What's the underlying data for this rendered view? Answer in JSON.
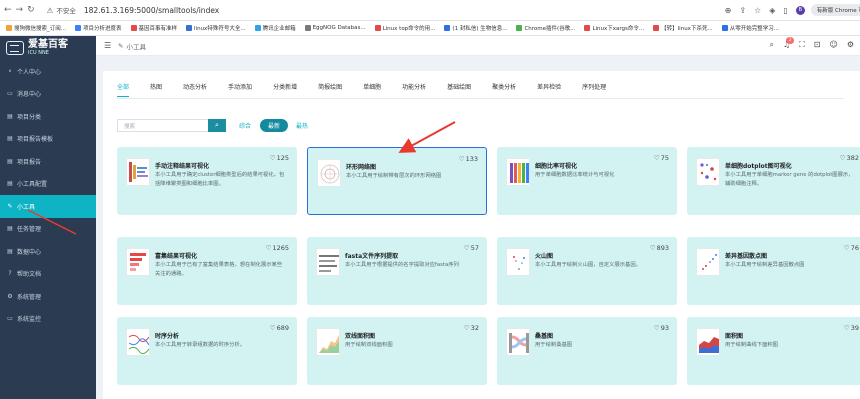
{
  "browser": {
    "nav": {
      "back": "←",
      "forward": "→",
      "reload": "↻"
    },
    "url_warning": "不安全",
    "url": "182.61.3.169:5000/smalltools/index",
    "profile_initial": "B",
    "update_label": "有新版 Chrome 可用"
  },
  "bookmarks": [
    {
      "label": "搜狗微信搜索_订阅...",
      "color": "#f1a33b"
    },
    {
      "label": "项目分析进度表",
      "color": "#3b82f6"
    },
    {
      "label": "基因百事有准样",
      "color": "#e14b4b"
    },
    {
      "label": "linux特殊符号大全...",
      "color": "#3b6fd6"
    },
    {
      "label": "腾讯企业邮箱",
      "color": "#2fa3e8"
    },
    {
      "label": "EggNOG Databas...",
      "color": "#7a7a7a"
    },
    {
      "label": "Linux top命令的用...",
      "color": "#e14b4b"
    },
    {
      "label": "(1 封私信) 生物信息...",
      "color": "#2f6fe8"
    },
    {
      "label": "Chrome插件(谷歌...",
      "color": "#4caf50"
    },
    {
      "label": "Linux下xargs命令...",
      "color": "#e14b4b"
    },
    {
      "label": "【转】linux下杀死...",
      "color": "#e14b4b"
    },
    {
      "label": "从零开始完整学习...",
      "color": "#2f6fe8"
    }
  ],
  "sidebar": {
    "logo_text": "爱基百客",
    "logo_sub": "ICU NNE",
    "items": [
      {
        "icon": "⚬",
        "label": "个人中心",
        "active": false
      },
      {
        "icon": "▭",
        "label": "消息中心",
        "active": false
      },
      {
        "icon": "▤",
        "label": "项目分类",
        "active": false
      },
      {
        "icon": "▤",
        "label": "项目报告模板",
        "active": false
      },
      {
        "icon": "▤",
        "label": "项目报告",
        "active": false
      },
      {
        "icon": "▤",
        "label": "小工具配置",
        "active": false
      },
      {
        "icon": "✎",
        "label": "小工具",
        "active": true
      },
      {
        "icon": "▤",
        "label": "任务管理",
        "active": false
      },
      {
        "icon": "▤",
        "label": "数据中心",
        "active": false
      },
      {
        "icon": "?",
        "label": "帮助文档",
        "active": false
      },
      {
        "icon": "⚙",
        "label": "系统管理",
        "active": false
      },
      {
        "icon": "▭",
        "label": "系统监控",
        "active": false
      }
    ]
  },
  "topbar": {
    "breadcrumb": "小工具",
    "notification_count": "2"
  },
  "tabs": [
    "全部",
    "热图",
    "动态分析",
    "手动添加",
    "分类新增",
    "简报绘图",
    "单细胞",
    "功能分析",
    "基础绘图",
    "聚类分析",
    "差异检验",
    "序列处理"
  ],
  "search": {
    "placeholder": "搜索",
    "sort_options": [
      "综合",
      "最新",
      "最热"
    ]
  },
  "cards": [
    {
      "title": "手动注释结果可视化",
      "desc": "本小工具用于确定cluster细胞类型后的结果可视化，包括降维聚类图和细胞比率图。",
      "likes": "125"
    },
    {
      "title": "环形网络图",
      "desc": "本小工具用于绘制带有层次的环形网络图",
      "likes": "133"
    },
    {
      "title": "细胞比率可视化",
      "desc": "用于单细胞数据比率统计与可视化",
      "likes": "75"
    },
    {
      "title": "单细胞dotplot图可视化",
      "desc": "本小工具用于单细胞marker gene 的dotplot图展示，辅助细胞注释。",
      "likes": "382"
    },
    {
      "title": "富集结果可视化",
      "desc": "本小工具用于已有了富集结果表格，想在制化展示某些关注的通路。",
      "likes": "1265"
    },
    {
      "title": "fasta文件序列提取",
      "desc": "本小工具用于根据提供的名字提取对应fasta序列",
      "likes": "57"
    },
    {
      "title": "火山图",
      "desc": "本小工具用于绘制火山图，自定义展示基因。",
      "likes": "893"
    },
    {
      "title": "差异基因散点图",
      "desc": "本小工具用于绘制差异基因散点图",
      "likes": "76"
    },
    {
      "title": "时序分析",
      "desc": "本小工具用于转录组数据的时序分析。",
      "likes": "689"
    },
    {
      "title": "双线面积图",
      "desc": "用于绘制双线面积图",
      "likes": "32"
    },
    {
      "title": "桑基图",
      "desc": "用于绘制桑基图",
      "likes": "93"
    },
    {
      "title": "面积图",
      "desc": "用于绘制曲线下面积图",
      "likes": "39"
    }
  ],
  "colors": {
    "accent": "#0fb4c4",
    "sidebar_bg": "#2b3b52",
    "card_bg": "#d3f3f3",
    "annotation_red": "#e83a2f"
  }
}
